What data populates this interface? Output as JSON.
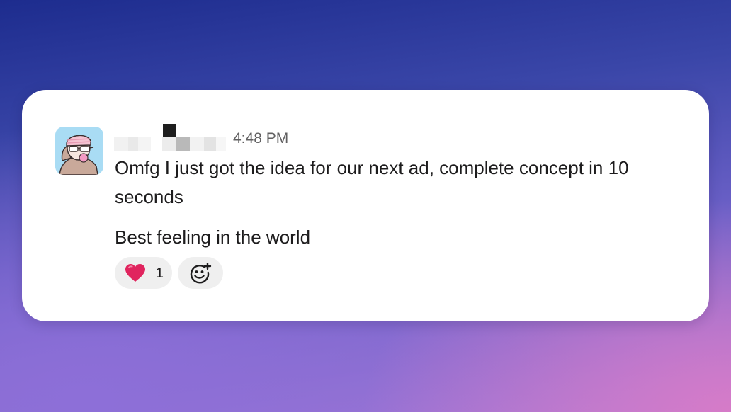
{
  "message": {
    "author_name_redacted": true,
    "timestamp": "4:48 PM",
    "paragraphs": [
      "Omfg I just got the idea for our next ad, complete concept in 10 seconds",
      "Best feeling in the world"
    ]
  },
  "reactions": [
    {
      "emoji": "heart-emoji",
      "count": "1"
    }
  ],
  "icons": {
    "add_reaction": "add-reaction-icon",
    "avatar": "avatar-illustration"
  },
  "colors": {
    "card_bg": "#ffffff",
    "text": "#1d1c1d",
    "timestamp": "#616061",
    "reaction_bg": "#efefef",
    "heart": "#e0245e",
    "avatar_bg": "#a9dcf4"
  }
}
